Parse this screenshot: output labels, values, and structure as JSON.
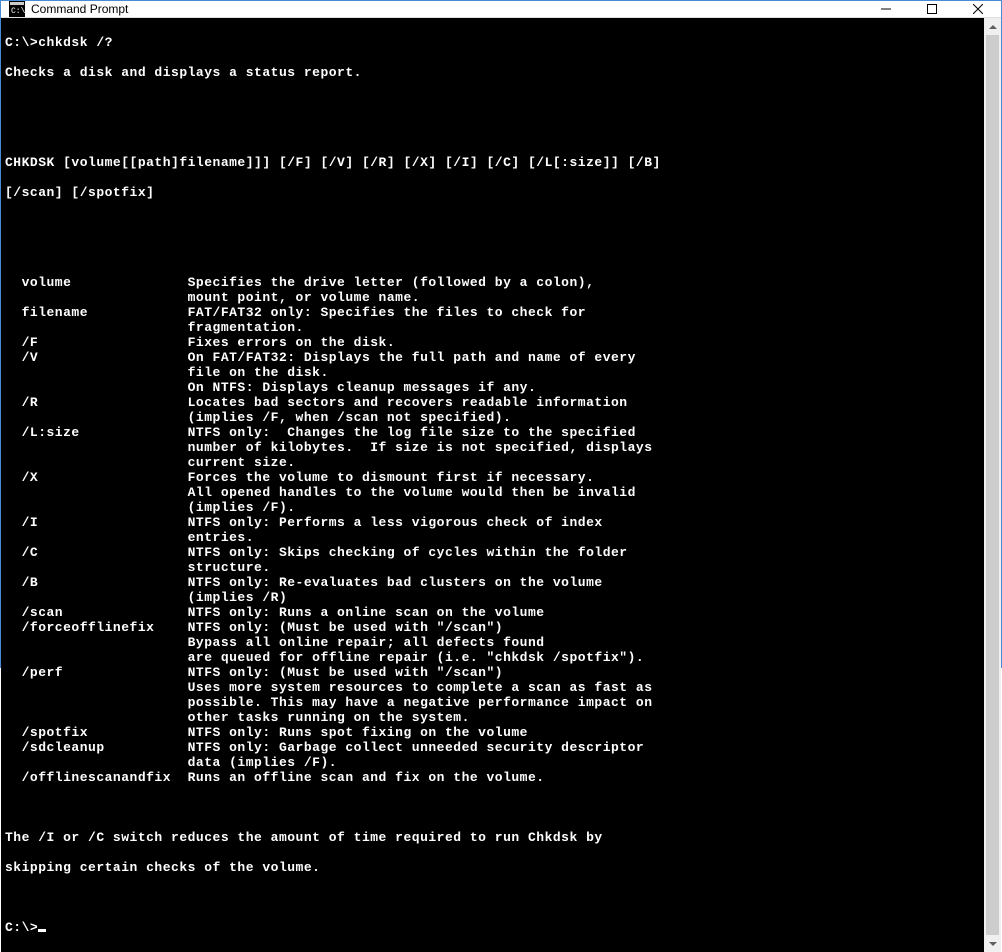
{
  "window": {
    "title": "Command Prompt"
  },
  "terminal": {
    "prompt1": "C:\\>",
    "command": "chkdsk /?",
    "desc": "Checks a disk and displays a status report.",
    "usage1": "CHKDSK [volume[[path]filename]]] [/F] [/V] [/R] [/X] [/I] [/C] [/L[:size]] [/B]",
    "usage2": "[/scan] [/spotfix]",
    "options": [
      {
        "key": "  volume",
        "desc": "Specifies the drive letter (followed by a colon),\n                      mount point, or volume name."
      },
      {
        "key": "  filename",
        "desc": "FAT/FAT32 only: Specifies the files to check for\n                      fragmentation."
      },
      {
        "key": "  /F",
        "desc": "Fixes errors on the disk."
      },
      {
        "key": "  /V",
        "desc": "On FAT/FAT32: Displays the full path and name of every\n                      file on the disk.\n                      On NTFS: Displays cleanup messages if any."
      },
      {
        "key": "  /R",
        "desc": "Locates bad sectors and recovers readable information\n                      (implies /F, when /scan not specified)."
      },
      {
        "key": "  /L:size",
        "desc": "NTFS only:  Changes the log file size to the specified\n                      number of kilobytes.  If size is not specified, displays\n                      current size."
      },
      {
        "key": "  /X",
        "desc": "Forces the volume to dismount first if necessary.\n                      All opened handles to the volume would then be invalid\n                      (implies /F)."
      },
      {
        "key": "  /I",
        "desc": "NTFS only: Performs a less vigorous check of index\n                      entries."
      },
      {
        "key": "  /C",
        "desc": "NTFS only: Skips checking of cycles within the folder\n                      structure."
      },
      {
        "key": "  /B",
        "desc": "NTFS only: Re-evaluates bad clusters on the volume\n                      (implies /R)"
      },
      {
        "key": "  /scan",
        "desc": "NTFS only: Runs a online scan on the volume"
      },
      {
        "key": "  /forceofflinefix",
        "desc": "NTFS only: (Must be used with \"/scan\")\n                      Bypass all online repair; all defects found\n                      are queued for offline repair (i.e. \"chkdsk /spotfix\")."
      },
      {
        "key": "  /perf",
        "desc": "NTFS only: (Must be used with \"/scan\")\n                      Uses more system resources to complete a scan as fast as\n                      possible. This may have a negative performance impact on\n                      other tasks running on the system."
      },
      {
        "key": "  /spotfix",
        "desc": "NTFS only: Runs spot fixing on the volume"
      },
      {
        "key": "  /sdcleanup",
        "desc": "NTFS only: Garbage collect unneeded security descriptor\n                      data (implies /F)."
      },
      {
        "key": "  /offlinescanandfix",
        "desc": "Runs an offline scan and fix on the volume."
      }
    ],
    "footer1": "The /I or /C switch reduces the amount of time required to run Chkdsk by",
    "footer2": "skipping certain checks of the volume.",
    "prompt2": "C:\\>"
  }
}
